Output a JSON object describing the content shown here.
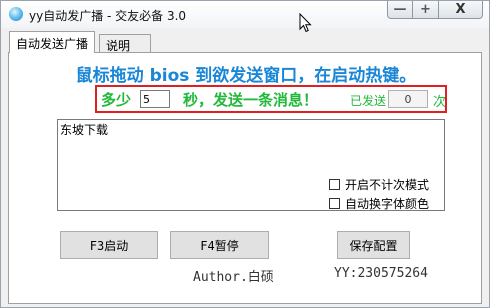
{
  "window": {
    "title": "yy自动发广播 - 交友必备  3.0",
    "controls": {
      "minimize": "—",
      "maximize": "+",
      "close": "X"
    }
  },
  "tabs": [
    {
      "label": "自动发送广播",
      "active": true
    },
    {
      "label": "说明",
      "active": false
    }
  ],
  "main": {
    "headline": "鼠标拖动 bios 到欲发送窗口，在启动热键。",
    "interval": {
      "prefix": "多少",
      "value": "5",
      "suffix": "秒，发送一条消息！",
      "sent_label": "已发送",
      "sent_count": "0",
      "sent_unit": "次"
    },
    "message_text": "东坡下载",
    "options": [
      {
        "label": "开启不计次模式",
        "checked": false
      },
      {
        "label": "自动换字体颜色",
        "checked": false
      }
    ],
    "buttons": {
      "start": "F3启动",
      "pause": "F4暂停",
      "save": "保存配置"
    },
    "author": "Author.白硕",
    "yy_id": "YY:230575264"
  },
  "colors": {
    "headline": "#1a86d8",
    "green": "#22b83a",
    "red_border": "#e02020"
  }
}
